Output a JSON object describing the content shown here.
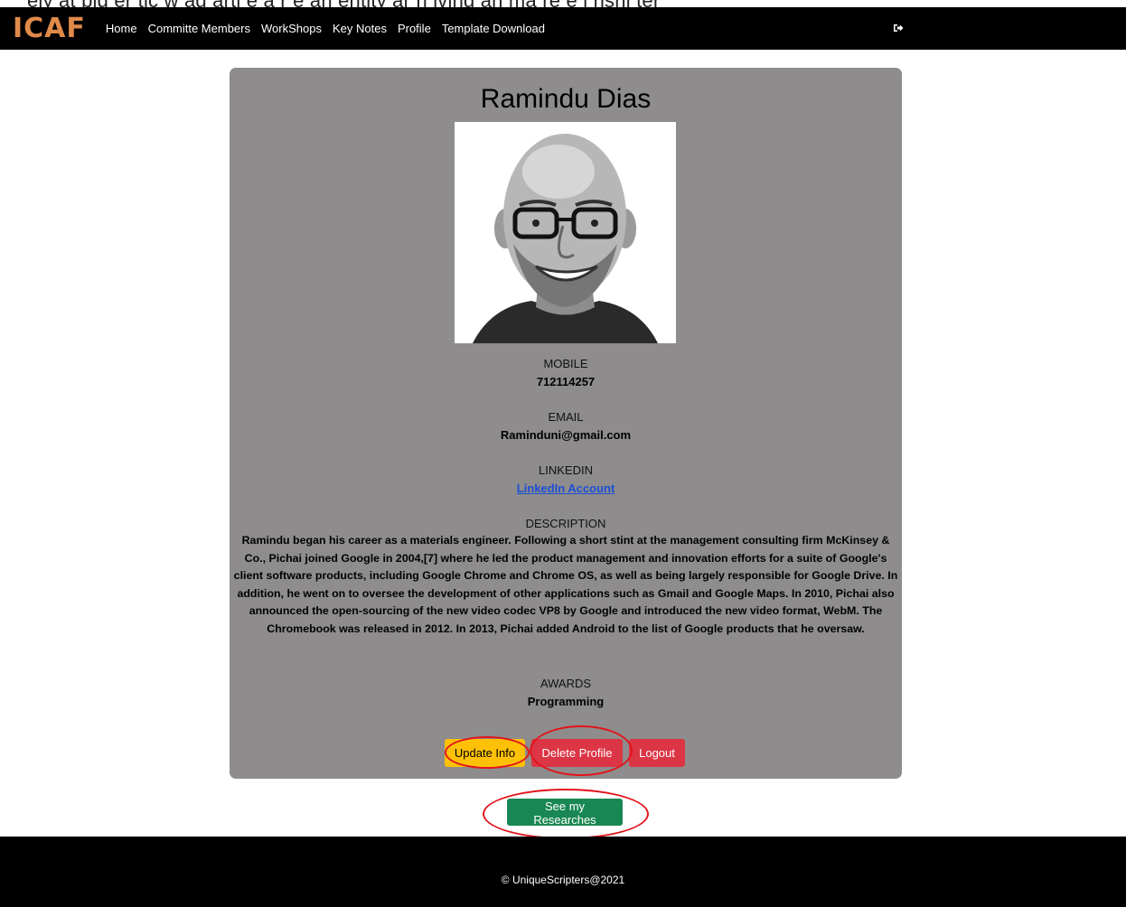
{
  "header_clip_text": "ely at big er tic w ag arti e a r e an entity ar n iving an ma re e i nshi ter",
  "nav": {
    "logo": "ICAF",
    "links": [
      "Home",
      "Committe Members",
      "WorkShops",
      "Key Notes",
      "Profile",
      "Template Download"
    ]
  },
  "profile": {
    "name": "Ramindu Dias",
    "fields": {
      "mobile_label": "MOBILE",
      "mobile_value": "712114257",
      "email_label": "EMAIL",
      "email_value": "Raminduni@gmail.com",
      "linkedin_label": "LINKEDIN",
      "linkedin_value": "LinkedIn Account",
      "description_label": "DESCRIPTION",
      "description_value": "Ramindu began his career as a materials engineer. Following a short stint at the management consulting firm McKinsey & Co., Pichai joined Google in 2004,[7] where he led the product management and innovation efforts for a suite of Google's client software products, including Google Chrome and Chrome OS, as well as being largely responsible for Google Drive. In addition, he went on to oversee the development of other applications such as Gmail and Google Maps. In 2010, Pichai also announced the open-sourcing of the new video codec VP8 by Google and introduced the new video format, WebM. The Chromebook was released in 2012. In 2013, Pichai added Android to the list of Google products that he oversaw.",
      "awards_label": "AWARDS",
      "awards_value": "Programming"
    },
    "buttons": {
      "update": "Update Info",
      "delete": "Delete Profile",
      "logout": "Logout"
    }
  },
  "research_button": "See my Researches",
  "footer": "© UniqueScripters@2021",
  "colors": {
    "card_bg": "#8e8c8c",
    "warning": "#ffc107",
    "danger": "#dc3545",
    "success": "#198754",
    "annotation": "#e2141b"
  }
}
